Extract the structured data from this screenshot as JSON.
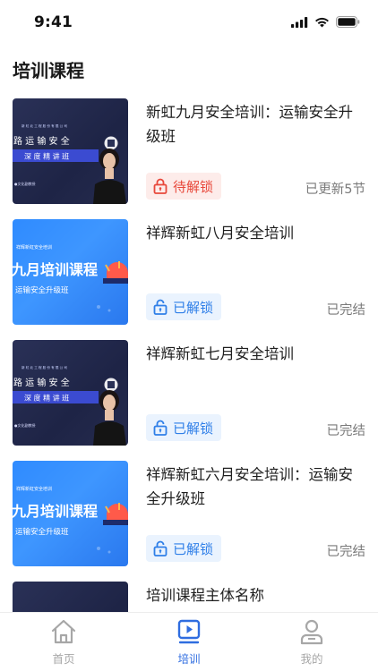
{
  "status_bar": {
    "time": "9:41"
  },
  "page": {
    "title": "培训课程"
  },
  "courses": [
    {
      "title": "新虹九月安全培训：运输安全升级班",
      "lock_label": "待解锁",
      "status": "已更新5节",
      "thumb": {
        "heading": "路 运 输 安 全",
        "subheading": "深 度 精 讲 班",
        "small_top": "新 虹 北 工 程 股 份 有 限 公 司",
        "footer": "●文化副教授"
      }
    },
    {
      "title": "祥辉新虹八月安全培训",
      "lock_label": "已解锁",
      "status": "已完结",
      "thumb": {
        "tag": "祥辉新虹安全培训",
        "heading": "九月培训课程",
        "subheading": "运输安全升级班"
      }
    },
    {
      "title": "祥辉新虹七月安全培训",
      "lock_label": "已解锁",
      "status": "已完结",
      "thumb": {
        "heading": "路 运 输 安 全",
        "subheading": "深 度 精 讲 班",
        "small_top": "新 虹 北 工 程 股 份 有 限 公 司",
        "footer": "●文化副教授"
      }
    },
    {
      "title": "祥辉新虹六月安全培训：运输安全升级班",
      "lock_label": "已解锁",
      "status": "已完结",
      "thumb": {
        "tag": "祥辉新虹安全培训",
        "heading": "九月培训课程",
        "subheading": "运输安全升级班"
      }
    },
    {
      "title": "培训课程主体名称",
      "lock_label": "",
      "status": "",
      "thumb": {}
    }
  ],
  "tabs": [
    {
      "label": "首页",
      "icon": "home-icon",
      "active": false
    },
    {
      "label": "培训",
      "icon": "video-play-icon",
      "active": true
    },
    {
      "label": "我的",
      "icon": "user-icon",
      "active": false
    }
  ],
  "colors": {
    "accent": "#2f6de0",
    "locked": "#e8483b",
    "unlocked": "#2f7fe8",
    "inactive_tab": "#a7a7a7"
  }
}
